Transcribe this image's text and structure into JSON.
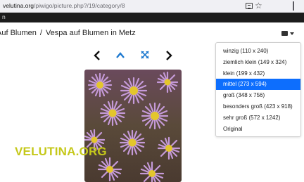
{
  "browser": {
    "url_host": "velutina.org",
    "url_path": "/piwigo/picture.php?/19/category/8",
    "tab_fragment": "n"
  },
  "breadcrumb": {
    "parent": "Auf Blumen",
    "separator": "/",
    "current": "Vespa auf Blumen in Metz",
    "shown_cropped_at_left": true
  },
  "navigation": {
    "previous_icon": "chevron-left-icon",
    "up_icon": "chevron-up-icon",
    "fullscreen_icon": "expand-arrows-icon",
    "next_icon": "chevron-right-icon"
  },
  "photo_sizes_button": {
    "icon": "image-icon",
    "caret_icon": "caret-down-icon"
  },
  "size_menu": {
    "items": [
      {
        "label": "winzig (110 x 240)",
        "active": false
      },
      {
        "label": "ziemlich klein (149 x 324)",
        "active": false
      },
      {
        "label": "klein (199 x 432)",
        "active": false
      },
      {
        "label": "mittel (273 x 594)",
        "active": true
      },
      {
        "label": "groß (348 x 756)",
        "active": false
      },
      {
        "label": "besonders groß (423 x 918)",
        "active": false
      },
      {
        "label": "sehr groß (572 x 1242)",
        "active": false
      },
      {
        "label": "Original",
        "active": false
      }
    ]
  },
  "picture": {
    "subject": "purple aster flowers"
  },
  "watermark": {
    "text": "VELUTINA.ORG"
  },
  "colors": {
    "accent": "#0d6efd",
    "watermark": "#c5c81a",
    "darkbar": "#1c1c1c"
  }
}
